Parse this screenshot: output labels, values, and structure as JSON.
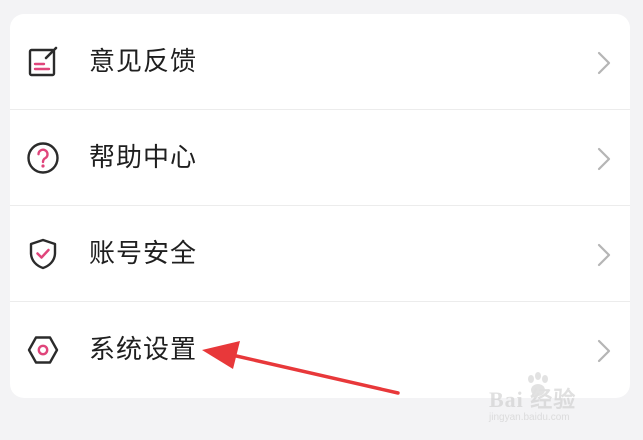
{
  "menu": {
    "items": [
      {
        "label": "意见反馈",
        "icon": "feedback-icon"
      },
      {
        "label": "帮助中心",
        "icon": "help-icon"
      },
      {
        "label": "账号安全",
        "icon": "shield-check-icon"
      },
      {
        "label": "系统设置",
        "icon": "settings-hexagon-icon"
      }
    ]
  },
  "colors": {
    "background": "#f3f3f5",
    "card": "#ffffff",
    "text": "#1f1f1f",
    "icon_outline": "#2b2b2b",
    "icon_accent": "#e0457b",
    "chevron": "#b5b5b5",
    "annotation_arrow": "#e8383a"
  },
  "watermark": {
    "text": "Bai 经验",
    "subtext": "jingyan.baidu.com"
  }
}
